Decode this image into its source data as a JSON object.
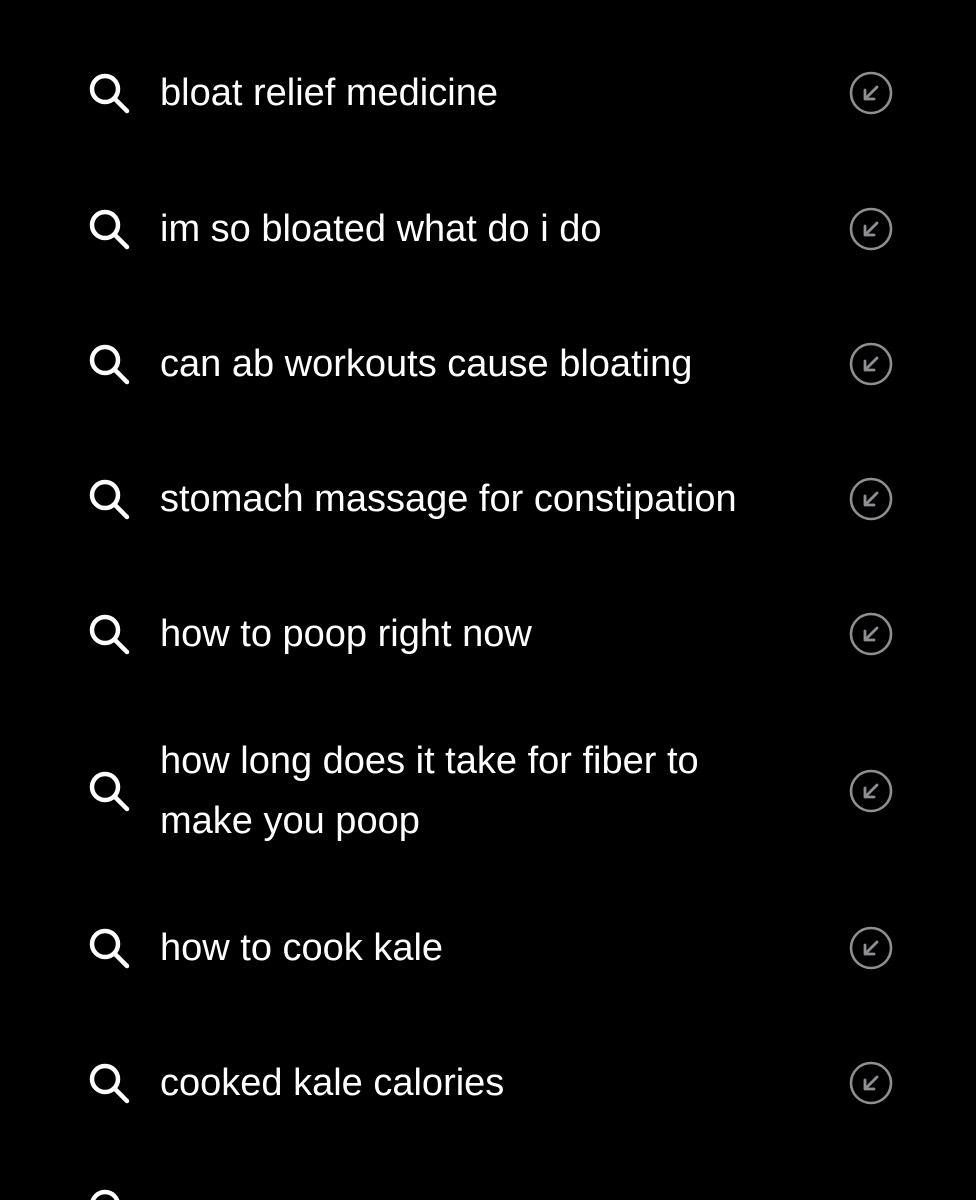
{
  "suggestions": [
    {
      "text": "bloat relief medicine"
    },
    {
      "text": "im so bloated what do i do"
    },
    {
      "text": "can ab workouts cause bloating"
    },
    {
      "text": "stomach massage for constipation"
    },
    {
      "text": "how to poop right now"
    },
    {
      "text": "how long does it take for fiber to make you poop"
    },
    {
      "text": "how to cook kale"
    },
    {
      "text": "cooked kale calories"
    }
  ],
  "icons": {
    "leading": "search-icon",
    "trailing": "arrow-up-left-circle-icon"
  },
  "colors": {
    "background": "#000000",
    "text": "#ffffff",
    "trailing_icon": "#8e8e93"
  }
}
